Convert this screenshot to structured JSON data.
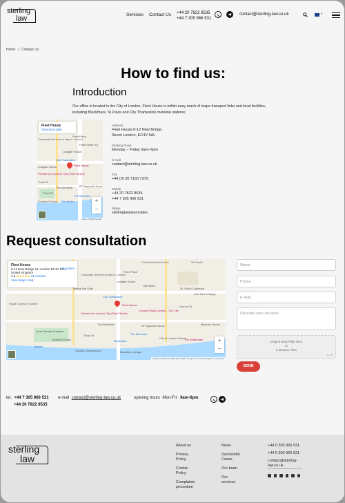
{
  "header": {
    "logo_line1": "sterling",
    "logo_line2": "law",
    "nav": [
      "Services",
      "Contact Us"
    ],
    "phone1": "+44 20 7822 8535",
    "phone2": "+44 7 305 966 531",
    "email": "contact@sterling-law.co.uk",
    "icons": [
      "whatsapp-icon",
      "telegram-icon",
      "search-icon",
      "uk-flag-icon",
      "menu-icon"
    ]
  },
  "breadcrumb": {
    "home": "Home",
    "separator": ">",
    "current": "Contact Us"
  },
  "page_title": "How to find us:",
  "intro": {
    "heading": "Introduction",
    "text": "Our office is located in the City of London. Fleet House is within easy reach of major transport links and local facilities, including Blackfriars, St Pauls and City Thameslink mainline stations:"
  },
  "map1": {
    "place": "Fleet House",
    "directions": "Directions plan",
    "zoom_in": "+",
    "zoom_out": "−",
    "labels": [
      "Consulate General of Italy in London",
      "Fleet Place",
      "Ludgate House",
      "City Thameslink",
      "Fleet House",
      "Ludgate Circus",
      "Premier Inn London City (Fleet Street)",
      "The Blackfriar",
      "BT Baynard House",
      "The Mermaid",
      "Blackfriars",
      "Scotland House",
      "Tudor St",
      "Fleet St",
      "Paternoster Sq"
    ],
    "attribution": "Карты ©2024 Google"
  },
  "details": {
    "address_label": "Address",
    "address_line1": "Fleet House 8-12 New Bridge",
    "address_line2": "Street London, EC4V 6AL",
    "hours_label": "Working hours",
    "hours": "Monday – Friday 9am–6pm",
    "email_label": "E-mail",
    "email": "contact@sterling-law.co.uk",
    "fax_label": "Fax",
    "fax": "+44 (0) 20 7183 7379",
    "mobile_label": "Mobile",
    "mobile1": "+44 20 7822 8535",
    "mobile2": "+44 7 305 966 531",
    "skype_label": "Skype",
    "skype": "sterlinglawassociates"
  },
  "consultation": {
    "heading": "Request consultation",
    "map": {
      "place": "Fleet House",
      "address": "8-12 New Bridge St, London EC4V 6AL, United Kingdom",
      "rating": "4.6",
      "reviews": "51 reviews",
      "view_larger": "View larger map",
      "directions": "Directions",
      "labels": [
        "Central Criminal Court",
        "St. Paul's",
        "Consulate General of Italy in London",
        "Fleet Place",
        "Ludgate House",
        "Temple Bar Gate",
        "Old Bailey",
        "St. Paul's Cathedral",
        "One New Change",
        "Fleet House",
        "City Thameslink",
        "Premier Inn London City (Fleet Street)",
        "Crowne Plaza London - The City",
        "Royal Courts of Justice",
        "The Blackfriar",
        "BT Baynard House",
        "Inner Temple Gardens",
        "The Mermaid",
        "Mansion House",
        "Scotland House",
        "Blackfriars",
        "City of London School",
        "The Watermark",
        "Tudor St",
        "Temple",
        "Cannon St",
        "Victoria Embankment",
        "Blackfriars Bridge"
      ],
      "attribution": "Keyboard shortcuts  Map data ©2024 Google  Terms of Use  Report a map error"
    },
    "form": {
      "name_placeholder": "Name",
      "phone_placeholder": "Phone",
      "email_placeholder": "E-mail",
      "message_placeholder": "Describe your situation",
      "upload_line1": "Drag & Drop Files Here",
      "upload_line2": "or",
      "upload_line3": "Browse Files",
      "upload_hint": "0 of 10",
      "send": "SEND"
    }
  },
  "contact_strip": {
    "tel_label": "tel.",
    "tel1": "+44 7 305 966 531",
    "tel2": "+44 20 7822 8535",
    "email_label": "e-mail",
    "email": "contact@sterling-law.co.uk",
    "hours_label": "opening hours",
    "hours_days": "Mon-Fri:",
    "hours_time": "9am-6pm"
  },
  "footer": {
    "logo_line1": "sterling",
    "logo_line2": "law",
    "col1": [
      "About us",
      "Privacy Policy",
      "Cookie Policy",
      "Complaints procedure"
    ],
    "col2": [
      "News",
      "Successful Cases",
      "Our team",
      "Our services"
    ],
    "phone1": "+44 0 305 966 531",
    "phone2": "+44 0 305 966 531",
    "email": "contact@sterling-law.co.uk",
    "social": [
      "linkedin-icon",
      "facebook-icon",
      "twitter-icon",
      "youtube-icon",
      "instagram-icon",
      "telegram-icon"
    ]
  }
}
